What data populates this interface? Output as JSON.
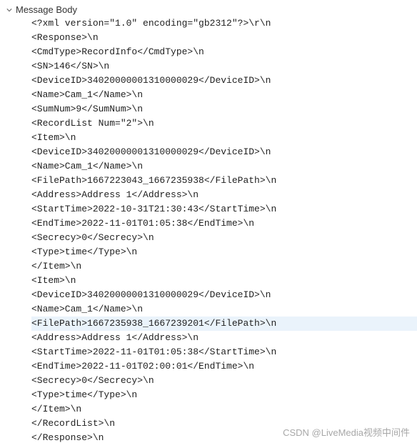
{
  "header": {
    "label": "Message Body"
  },
  "lines": [
    {
      "text": "<?xml version=\"1.0\" encoding=\"gb2312\"?>\\r\\n",
      "highlight": false
    },
    {
      "text": "<Response>\\n",
      "highlight": false
    },
    {
      "text": "<CmdType>RecordInfo</CmdType>\\n",
      "highlight": false
    },
    {
      "text": "<SN>146</SN>\\n",
      "highlight": false
    },
    {
      "text": "<DeviceID>34020000001310000029</DeviceID>\\n",
      "highlight": false
    },
    {
      "text": "<Name>Cam_1</Name>\\n",
      "highlight": false
    },
    {
      "text": "<SumNum>9</SumNum>\\n",
      "highlight": false
    },
    {
      "text": "<RecordList Num=\"2\">\\n",
      "highlight": false
    },
    {
      "text": "<Item>\\n",
      "highlight": false
    },
    {
      "text": "<DeviceID>34020000001310000029</DeviceID>\\n",
      "highlight": false
    },
    {
      "text": "<Name>Cam_1</Name>\\n",
      "highlight": false
    },
    {
      "text": "<FilePath>1667223043_1667235938</FilePath>\\n",
      "highlight": false
    },
    {
      "text": "<Address>Address 1</Address>\\n",
      "highlight": false
    },
    {
      "text": "<StartTime>2022-10-31T21:30:43</StartTime>\\n",
      "highlight": false
    },
    {
      "text": "<EndTime>2022-11-01T01:05:38</EndTime>\\n",
      "highlight": false
    },
    {
      "text": "<Secrecy>0</Secrecy>\\n",
      "highlight": false
    },
    {
      "text": "<Type>time</Type>\\n",
      "highlight": false
    },
    {
      "text": "</Item>\\n",
      "highlight": false
    },
    {
      "text": "<Item>\\n",
      "highlight": false
    },
    {
      "text": "<DeviceID>34020000001310000029</DeviceID>\\n",
      "highlight": false
    },
    {
      "text": "<Name>Cam_1</Name>\\n",
      "highlight": false
    },
    {
      "text": "<FilePath>1667235938_1667239201</FilePath>\\n",
      "highlight": true
    },
    {
      "text": "<Address>Address 1</Address>\\n",
      "highlight": false
    },
    {
      "text": "<StartTime>2022-11-01T01:05:38</StartTime>\\n",
      "highlight": false
    },
    {
      "text": "<EndTime>2022-11-01T02:00:01</EndTime>\\n",
      "highlight": false
    },
    {
      "text": "<Secrecy>0</Secrecy>\\n",
      "highlight": false
    },
    {
      "text": "<Type>time</Type>\\n",
      "highlight": false
    },
    {
      "text": "</Item>\\n",
      "highlight": false
    },
    {
      "text": "</RecordList>\\n",
      "highlight": false
    },
    {
      "text": "</Response>\\n",
      "highlight": false
    }
  ],
  "watermark": "CSDN @LiveMedia视频中间件"
}
